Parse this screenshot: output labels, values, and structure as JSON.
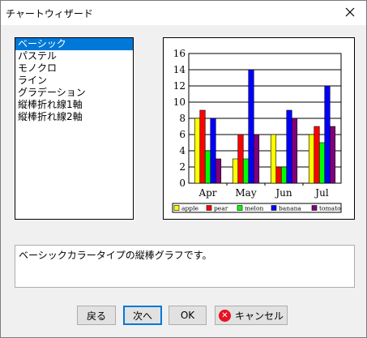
{
  "window": {
    "title": "チャートウィザード"
  },
  "list": {
    "items": [
      "ベーシック",
      "パステル",
      "モノクロ",
      "ライン",
      "グラデーション",
      "縦棒折れ線1軸",
      "縦棒折れ線2軸"
    ],
    "selected_index": 0
  },
  "description": "ベーシックカラータイプの縦棒グラフです。",
  "buttons": {
    "back": "戻る",
    "next": "次へ",
    "ok": "OK",
    "cancel": "キャンセル"
  },
  "icons": {
    "close": "close-icon",
    "cancel": "cancel-x-icon"
  },
  "chart_data": {
    "type": "bar",
    "categories": [
      "Apr",
      "May",
      "Jun",
      "Jul"
    ],
    "series": [
      {
        "name": "apple",
        "color": "#ffff00",
        "values": [
          8,
          3,
          6,
          6
        ]
      },
      {
        "name": "pear",
        "color": "#ff0000",
        "values": [
          9,
          6,
          2,
          7
        ]
      },
      {
        "name": "melon",
        "color": "#00ff00",
        "values": [
          4,
          3,
          2,
          5
        ]
      },
      {
        "name": "banana",
        "color": "#0000ff",
        "values": [
          8,
          14,
          9,
          12
        ]
      },
      {
        "name": "tomato",
        "color": "#800080",
        "values": [
          3,
          6,
          8,
          7
        ]
      }
    ],
    "ylim": [
      0,
      16
    ],
    "yticks": [
      "0",
      "2",
      "4",
      "6",
      "8",
      "10",
      "12",
      "14",
      "16"
    ],
    "grid": true,
    "legend": "bottom"
  }
}
